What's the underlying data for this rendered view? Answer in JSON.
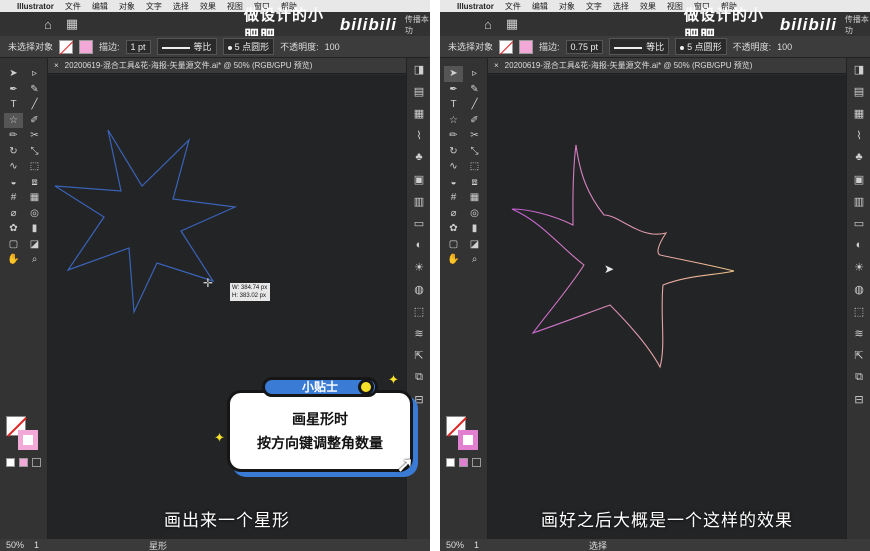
{
  "menubar": {
    "app": "Illustrator",
    "items": [
      "文件",
      "编辑",
      "对象",
      "文字",
      "选择",
      "效果",
      "视图",
      "窗口",
      "帮助"
    ]
  },
  "brand": {
    "text": "做设计的小肥肥",
    "logo": "bilibili",
    "tiny": "传播本功"
  },
  "left": {
    "control": {
      "selection": "未选择对象",
      "stroke_label": "描边:",
      "stroke_value": "1 pt",
      "profile": "等比",
      "brush": "5 点圆形",
      "opacity_label": "不透明度:",
      "opacity_value": "100"
    },
    "tab": "20200619-混合工具&花-海报-矢量源文件.ai* @ 50% (RGB/GPU 预览)",
    "readout_w": "W: 384.74 px",
    "readout_h": "H: 383.02 px",
    "subtitle": "画出来一个星形",
    "status": {
      "zoom": "50%",
      "page": "1",
      "tool": "星形"
    },
    "tip": {
      "badge": "小贴士",
      "line1": "画星形时",
      "line2": "按方向键调整角数量"
    }
  },
  "right": {
    "control": {
      "selection": "未选择对象",
      "stroke_label": "描边:",
      "stroke_value": "0.75 pt",
      "profile": "等比",
      "brush": "5 点圆形",
      "opacity_label": "不透明度:",
      "opacity_value": "100"
    },
    "tab": "20200619-混合工具&花-海报-矢量源文件.ai* @ 50% (RGB/GPU 预览)",
    "subtitle": "画好之后大概是一个这样的效果",
    "status": {
      "zoom": "50%",
      "page": "1",
      "tool": "选择"
    }
  },
  "tools": [
    "selection-icon",
    "direct-select-icon",
    "pen-icon",
    "curvature-icon",
    "type-icon",
    "line-icon",
    "star-icon",
    "brush-icon",
    "blob-brush-icon",
    "scissors-icon",
    "rotate-icon",
    "scale-icon",
    "warp-icon",
    "free-transform-icon",
    "shape-builder-icon",
    "perspective-icon",
    "mesh-icon",
    "gradient-icon",
    "eyedropper-icon",
    "blend-icon",
    "symbol-icon",
    "graph-icon",
    "artboard-icon",
    "slice-icon",
    "hand-icon",
    "zoom-icon"
  ],
  "colors": {
    "star_stroke": "#3a63b8",
    "flower_gradient_start": "#c85fd8",
    "flower_gradient_end": "#f2c58a",
    "accent_blue": "#3a7bd5",
    "accent_yellow": "#f7e12b",
    "fill_pink": "#f3a9d8"
  }
}
